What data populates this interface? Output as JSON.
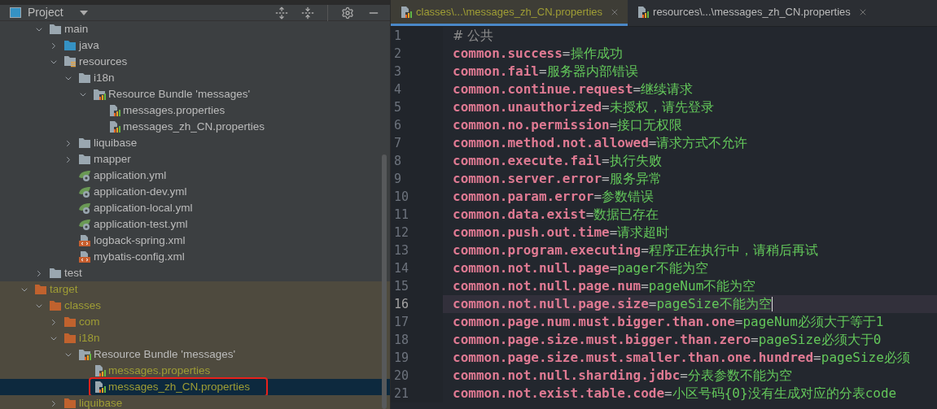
{
  "project_panel": {
    "title": "Project",
    "tree": [
      {
        "children": [
          {
            "label": "main",
            "kind": "folder",
            "expanded": true,
            "excluded": false,
            "selected": false,
            "annotated": false,
            "children": [
              {
                "label": "java",
                "kind": "source-folder",
                "expanded": false,
                "excluded": false,
                "selected": false,
                "annotated": false
              },
              {
                "label": "resources",
                "kind": "resources-folder",
                "expanded": true,
                "excluded": false,
                "selected": false,
                "annotated": false,
                "children": [
                  {
                    "label": "i18n",
                    "kind": "folder",
                    "expanded": true,
                    "excluded": false,
                    "selected": false,
                    "annotated": false,
                    "children": [
                      {
                        "label": "Resource Bundle 'messages'",
                        "kind": "bundle",
                        "expanded": true,
                        "excluded": false,
                        "selected": false,
                        "annotated": false,
                        "children": [
                          {
                            "label": "messages.properties",
                            "kind": "properties",
                            "excluded": false,
                            "selected": false,
                            "annotated": false
                          },
                          {
                            "label": "messages_zh_CN.properties",
                            "kind": "properties",
                            "excluded": false,
                            "selected": false,
                            "annotated": false
                          }
                        ]
                      }
                    ]
                  },
                  {
                    "label": "liquibase",
                    "kind": "folder",
                    "expanded": false,
                    "excluded": false,
                    "selected": false,
                    "annotated": false
                  },
                  {
                    "label": "mapper",
                    "kind": "folder",
                    "expanded": false,
                    "excluded": false,
                    "selected": false,
                    "annotated": false
                  },
                  {
                    "label": "application.yml",
                    "kind": "spring",
                    "excluded": false,
                    "selected": false,
                    "annotated": false
                  },
                  {
                    "label": "application-dev.yml",
                    "kind": "spring",
                    "excluded": false,
                    "selected": false,
                    "annotated": false
                  },
                  {
                    "label": "application-local.yml",
                    "kind": "spring",
                    "excluded": false,
                    "selected": false,
                    "annotated": false
                  },
                  {
                    "label": "application-test.yml",
                    "kind": "spring",
                    "excluded": false,
                    "selected": false,
                    "annotated": false
                  },
                  {
                    "label": "logback-spring.xml",
                    "kind": "xml",
                    "excluded": false,
                    "selected": false,
                    "annotated": false
                  },
                  {
                    "label": "mybatis-config.xml",
                    "kind": "xml",
                    "excluded": false,
                    "selected": false,
                    "annotated": false
                  }
                ]
              }
            ]
          },
          {
            "label": "test",
            "kind": "folder",
            "expanded": false,
            "excluded": false,
            "selected": false,
            "annotated": false
          }
        ]
      },
      {
        "label": "target",
        "kind": "folder",
        "expanded": true,
        "excluded": true,
        "selected": false,
        "annotated": false,
        "children": [
          {
            "label": "classes",
            "kind": "folder",
            "expanded": true,
            "excluded": true,
            "selected": false,
            "annotated": false,
            "children": [
              {
                "label": "com",
                "kind": "folder",
                "expanded": false,
                "excluded": true,
                "selected": false,
                "annotated": false
              },
              {
                "label": "i18n",
                "kind": "folder",
                "expanded": true,
                "excluded": true,
                "selected": false,
                "annotated": false,
                "children": [
                  {
                    "label": "Resource Bundle 'messages'",
                    "kind": "bundle",
                    "expanded": true,
                    "excluded": true,
                    "selected": false,
                    "annotated": false,
                    "children": [
                      {
                        "label": "messages.properties",
                        "kind": "properties",
                        "excluded": true,
                        "selected": false,
                        "annotated": false
                      },
                      {
                        "label": "messages_zh_CN.properties",
                        "kind": "properties",
                        "excluded": true,
                        "selected": true,
                        "annotated": true
                      }
                    ]
                  }
                ]
              },
              {
                "label": "liquibase",
                "kind": "folder",
                "expanded": false,
                "excluded": true,
                "selected": false,
                "annotated": false
              }
            ]
          }
        ]
      }
    ]
  },
  "editor": {
    "tabs": [
      {
        "label": "classes\\...\\messages_zh_CN.properties",
        "selected": true,
        "excluded": true
      },
      {
        "label": "resources\\...\\messages_zh_CN.properties",
        "selected": false,
        "excluded": false
      }
    ],
    "lines": [
      {
        "number": "1",
        "kind": "comment",
        "text": "# 公共",
        "current": false
      },
      {
        "number": "2",
        "kind": "property",
        "key": "common.success",
        "separator": "=",
        "value": "操作成功",
        "current": false
      },
      {
        "number": "3",
        "kind": "property",
        "key": "common.fail",
        "separator": "=",
        "value": "服务器内部错误",
        "current": false
      },
      {
        "number": "4",
        "kind": "property",
        "key": "common.continue.request",
        "separator": "=",
        "value": "继续请求",
        "current": false
      },
      {
        "number": "5",
        "kind": "property",
        "key": "common.unauthorized",
        "separator": "=",
        "value": "未授权，请先登录",
        "current": false
      },
      {
        "number": "6",
        "kind": "property",
        "key": "common.no.permission",
        "separator": "=",
        "value": "接口无权限",
        "current": false
      },
      {
        "number": "7",
        "kind": "property",
        "key": "common.method.not.allowed",
        "separator": "=",
        "value": "请求方式不允许",
        "current": false
      },
      {
        "number": "8",
        "kind": "property",
        "key": "common.execute.fail",
        "separator": "=",
        "value": "执行失败",
        "current": false
      },
      {
        "number": "9",
        "kind": "property",
        "key": "common.server.error",
        "separator": "=",
        "value": "服务异常",
        "current": false
      },
      {
        "number": "10",
        "kind": "property",
        "key": "common.param.error",
        "separator": "=",
        "value": "参数错误",
        "current": false
      },
      {
        "number": "11",
        "kind": "property",
        "key": "common.data.exist",
        "separator": "=",
        "value": "数据已存在",
        "current": false
      },
      {
        "number": "12",
        "kind": "property",
        "key": "common.push.out.time",
        "separator": "=",
        "value": "请求超时",
        "current": false
      },
      {
        "number": "13",
        "kind": "property",
        "key": "common.program.executing",
        "separator": "=",
        "value": "程序正在执行中，请稍后再试",
        "current": false
      },
      {
        "number": "14",
        "kind": "property",
        "key": "common.not.null.page",
        "separator": "=",
        "value": "pager不能为空",
        "current": false
      },
      {
        "number": "15",
        "kind": "property",
        "key": "common.not.null.page.num",
        "separator": "=",
        "value": "pageNum不能为空",
        "current": false
      },
      {
        "number": "16",
        "kind": "property",
        "key": "common.not.null.page.size",
        "separator": "=",
        "value": "pageSize不能为空",
        "current": true
      },
      {
        "number": "17",
        "kind": "property",
        "key": "common.page.num.must.bigger.than.one",
        "separator": "=",
        "value": "pageNum必须大于等于1",
        "current": false
      },
      {
        "number": "18",
        "kind": "property",
        "key": "common.page.size.must.bigger.than.zero",
        "separator": "=",
        "value": "pageSize必须大于0",
        "current": false
      },
      {
        "number": "19",
        "kind": "property",
        "key": "common.page.size.must.smaller.than.one.hundred",
        "separator": "=",
        "value": "pageSize必须",
        "current": false
      },
      {
        "number": "20",
        "kind": "property",
        "key": "common.not.null.sharding.jdbc",
        "separator": "=",
        "value": "分表参数不能为空",
        "current": false
      },
      {
        "number": "21",
        "kind": "property",
        "key": "common.not.exist.table.code",
        "separator": "=",
        "value": "小区号码{0}没有生成对应的分表code",
        "current": false
      }
    ]
  }
}
